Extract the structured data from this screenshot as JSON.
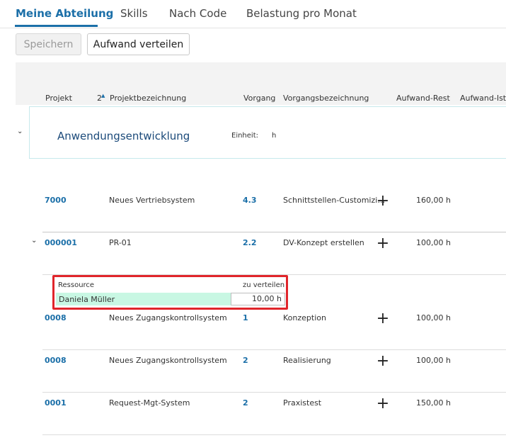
{
  "tabs": [
    {
      "label": "Meine Abteilung",
      "active": true
    },
    {
      "label": "Skills",
      "active": false
    },
    {
      "label": "Nach Code",
      "active": false
    },
    {
      "label": "Belastung pro Monat",
      "active": false
    }
  ],
  "toolbar": {
    "save_label": "Speichern",
    "distribute_label": "Aufwand verteilen"
  },
  "table": {
    "headers": {
      "projekt": "Projekt",
      "sort_index": "2",
      "projektbezeichnung": "Projektbezeichnung",
      "vorgang": "Vorgang",
      "vorgangsbezeichnung": "Vorgangsbezeichnung",
      "aufwand_rest": "Aufwand-Rest",
      "aufwand_ist": "Aufwand-Ist"
    },
    "group": {
      "title": "Anwendungsentwicklung",
      "unit_label": "Einheit:",
      "unit_value": "h"
    },
    "rows": [
      {
        "projekt": "7000",
        "bezeichnung": "Neues Vertriebsystem",
        "vorgang": "4.3",
        "vorgangsbezeichnung": "Schnittstellen-Customizi…",
        "rest": "160,00 h"
      },
      {
        "projekt": "000001",
        "bezeichnung": "PR-01",
        "vorgang": "2.2",
        "vorgangsbezeichnung": "DV-Konzept erstellen",
        "rest": "100,00 h"
      },
      {
        "projekt": "0008",
        "bezeichnung": "Neues Zugangskontrollsystem",
        "vorgang": "1",
        "vorgangsbezeichnung": "Konzeption",
        "rest": "100,00 h"
      },
      {
        "projekt": "0008",
        "bezeichnung": "Neues Zugangskontrollsystem",
        "vorgang": "2",
        "vorgangsbezeichnung": "Realisierung",
        "rest": "100,00 h"
      },
      {
        "projekt": "0001",
        "bezeichnung": "Request-Mgt-System",
        "vorgang": "2",
        "vorgangsbezeichnung": "Praxistest",
        "rest": "150,00 h"
      }
    ]
  },
  "popup": {
    "col_resource": "Ressource",
    "col_distribute": "zu verteilen",
    "resource_name": "Daniela Müller",
    "amount": "10,00 h"
  },
  "icons": {
    "add": "+",
    "sort": "▲",
    "chevron": "⌄"
  },
  "colors": {
    "accent": "#1b6fa8",
    "highlight_border": "#e0252b",
    "selected_row": "#c8f7e3"
  }
}
